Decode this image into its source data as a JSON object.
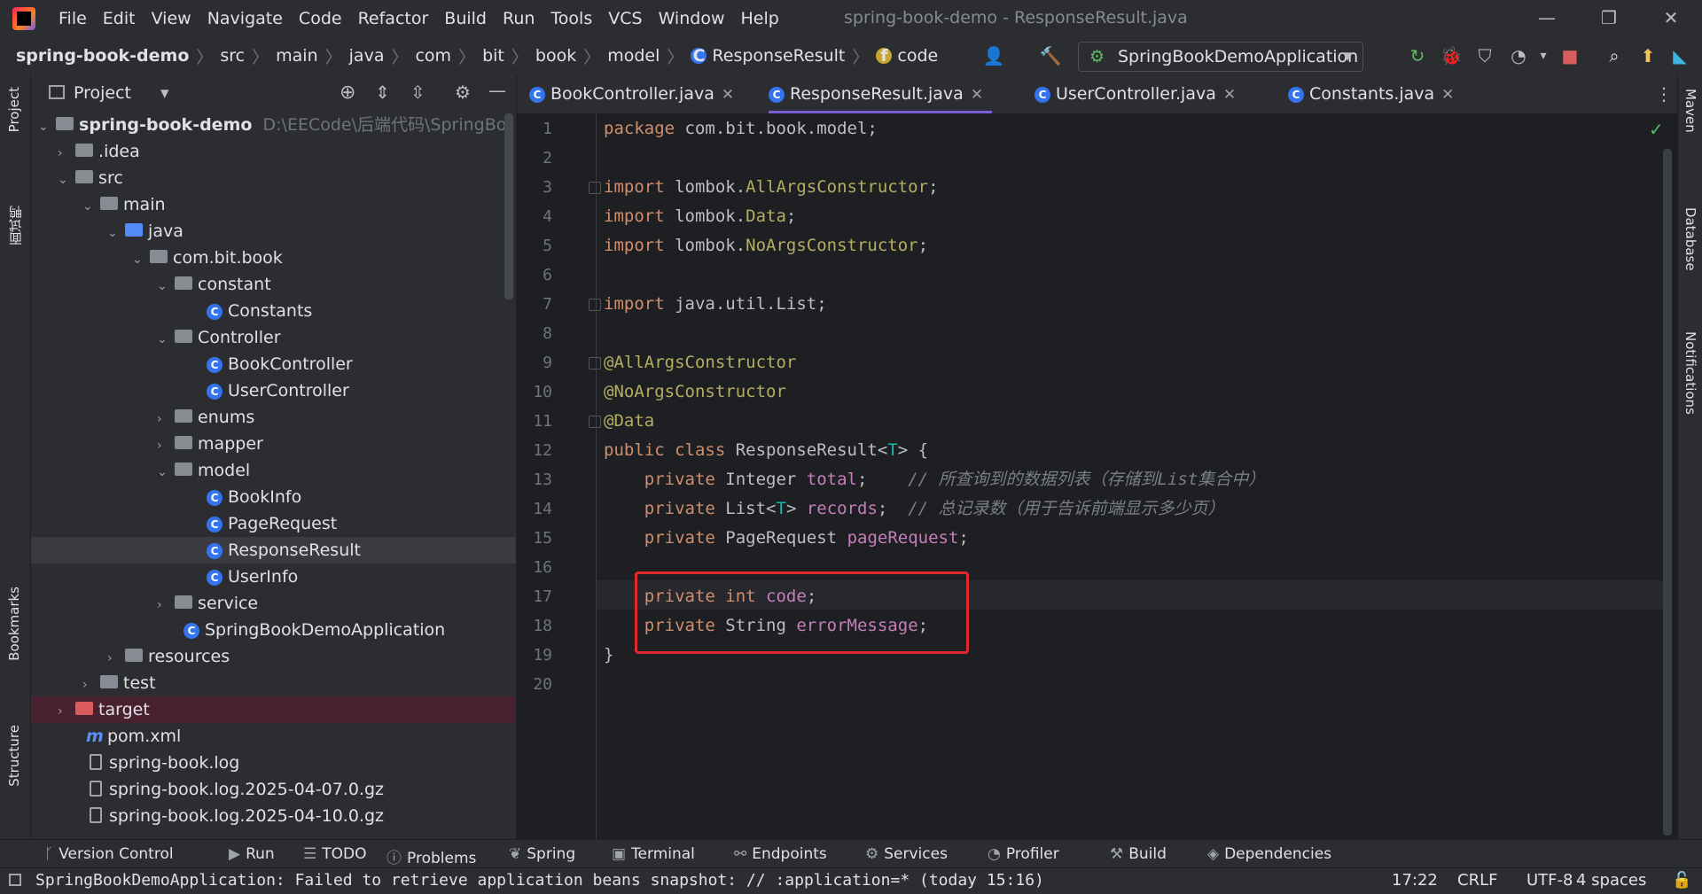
{
  "window": {
    "title": "spring-book-demo - ResponseResult.java",
    "menu": [
      "File",
      "Edit",
      "View",
      "Navigate",
      "Code",
      "Refactor",
      "Build",
      "Run",
      "Tools",
      "VCS",
      "Window",
      "Help"
    ]
  },
  "breadcrumb": [
    "spring-book-demo",
    "src",
    "main",
    "java",
    "com",
    "bit",
    "book",
    "model",
    "ResponseResult",
    "code"
  ],
  "run_config": "SpringBookDemoApplication",
  "left_stripe": [
    "Project",
    "面试鸭",
    "Bookmarks",
    "Structure"
  ],
  "right_stripe": [
    "Maven",
    "Database",
    "Notifications"
  ],
  "project": {
    "title": "Project",
    "root": "spring-book-demo",
    "root_path": "D:\\EECode\\后端代码\\SpringBo",
    "tree": [
      {
        "label": ".idea"
      },
      {
        "label": "src"
      },
      {
        "label": "main"
      },
      {
        "label": "java"
      },
      {
        "label": "com.bit.book"
      },
      {
        "label": "constant"
      },
      {
        "label": "Constants"
      },
      {
        "label": "Controller"
      },
      {
        "label": "BookController"
      },
      {
        "label": "UserController"
      },
      {
        "label": "enums"
      },
      {
        "label": "mapper"
      },
      {
        "label": "model"
      },
      {
        "label": "BookInfo"
      },
      {
        "label": "PageRequest"
      },
      {
        "label": "ResponseResult"
      },
      {
        "label": "UserInfo"
      },
      {
        "label": "service"
      },
      {
        "label": "SpringBookDemoApplication"
      },
      {
        "label": "resources"
      },
      {
        "label": "test"
      },
      {
        "label": "target"
      },
      {
        "label": "pom.xml"
      },
      {
        "label": "spring-book.log"
      },
      {
        "label": "spring-book.log.2025-04-07.0.gz"
      },
      {
        "label": "spring-book.log.2025-04-10.0.gz"
      }
    ]
  },
  "editor": {
    "tabs": [
      "BookController.java",
      "ResponseResult.java",
      "UserController.java",
      "Constants.java"
    ],
    "active_tab": "ResponseResult.java",
    "line_numbers": [
      "1",
      "2",
      "3",
      "4",
      "5",
      "6",
      "7",
      "8",
      "9",
      "10",
      "11",
      "12",
      "13",
      "14",
      "15",
      "16",
      "17",
      "18",
      "19",
      "20"
    ],
    "code": {
      "l1_kw": "package",
      "l1_rest": " com.bit.book.model;",
      "l3_kw": "import",
      "l3_a": " lombok.",
      "l3_b": "AllArgsConstructor",
      "l3_c": ";",
      "l4_kw": "import",
      "l4_a": " lombok.",
      "l4_b": "Data",
      "l4_c": ";",
      "l5_kw": "import",
      "l5_a": " lombok.",
      "l5_b": "NoArgsConstructor",
      "l5_c": ";",
      "l7_kw": "import",
      "l7_rest": " java.util.List;",
      "l9": "@AllArgsConstructor",
      "l10": "@NoArgsConstructor",
      "l11": "@Data",
      "l12_kw": "public class",
      "l12_a": " ResponseResult<",
      "l12_t": "T",
      "l12_b": "> {",
      "l13_kw": "    private",
      "l13_a": " Integer ",
      "l13_f": "total",
      "l13_b": ";    ",
      "l13_c": "// 所查询到的数据列表（存储到List集合中）",
      "l14_kw": "    private",
      "l14_a": " List<",
      "l14_t": "T",
      "l14_b": "> ",
      "l14_f": "records",
      "l14_s": ";  ",
      "l14_c": "// 总记录数（用于告诉前端显示多少页）",
      "l15_kw": "    private",
      "l15_a": " PageRequest ",
      "l15_f": "pageRequest",
      "l15_b": ";",
      "l17_kw": "    private int",
      "l17_sp": " ",
      "l17_f": "code",
      "l17_b": ";",
      "l18_kw": "    private",
      "l18_a": " String ",
      "l18_f": "errorMessage",
      "l18_b": ";",
      "l19": "}"
    }
  },
  "bottom_tools": [
    "Version Control",
    "Run",
    "TODO",
    "Problems",
    "Spring",
    "Terminal",
    "Endpoints",
    "Services",
    "Profiler",
    "Build",
    "Dependencies"
  ],
  "status": {
    "message": "SpringBookDemoApplication: Failed to retrieve application beans snapshot: // :application=* (today 15:16)",
    "position": "17:22",
    "line_sep": "CRLF",
    "encoding": "UTF-8",
    "indent": "4 spaces"
  },
  "colors": {
    "accent_tab": "#7a5bd8",
    "highlight_box": "#e0292f",
    "keyword": "#cf8e6d",
    "annotation": "#b3ae60",
    "field": "#c77dbb"
  }
}
